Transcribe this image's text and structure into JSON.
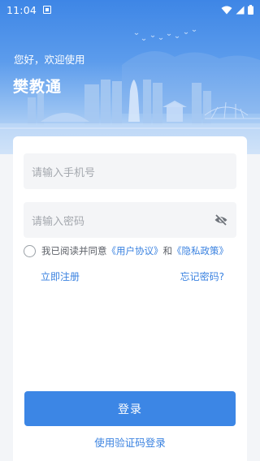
{
  "status": {
    "time": "11:04"
  },
  "header": {
    "greeting": "您好，欢迎使用",
    "app_name": "樊教通"
  },
  "form": {
    "phone_placeholder": "请输入手机号",
    "password_placeholder": "请输入密码",
    "agreement_prefix": "我已阅读并同意",
    "user_agreement": "《用户协议》",
    "agreement_and": "和",
    "privacy_policy": "《隐私政策》",
    "register": "立即注册",
    "forgot_password": "忘记密码?",
    "login_button": "登录",
    "sms_login": "使用验证码登录"
  },
  "colors": {
    "accent": "#3c86e5",
    "hero_top": "#3e86e6"
  }
}
